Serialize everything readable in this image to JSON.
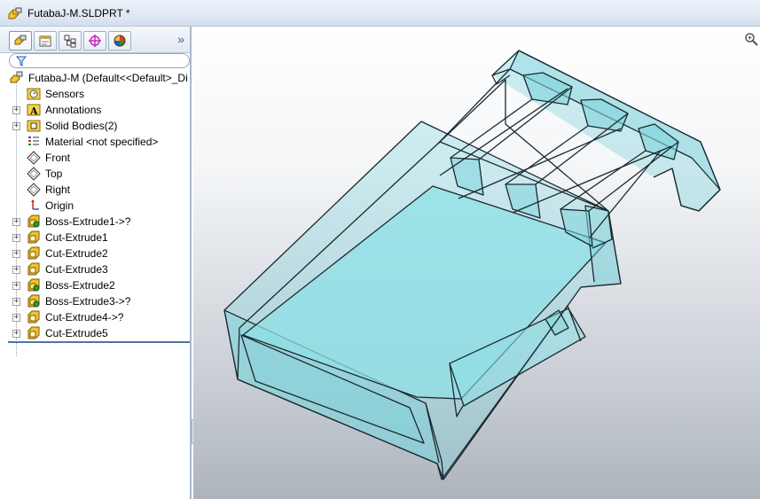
{
  "window": {
    "title": "FutabaJ-M.SLDPRT *"
  },
  "tabs": [
    {
      "icon": "feature-manager-icon"
    },
    {
      "icon": "property-manager-icon"
    },
    {
      "icon": "configuration-manager-icon"
    },
    {
      "icon": "dimxpert-manager-icon"
    },
    {
      "icon": "display-manager-icon"
    }
  ],
  "tabs_more": "»",
  "tree": {
    "root_label": "FutabaJ-M  (Default<<Default>_Di",
    "items": [
      {
        "label": "Sensors",
        "icon": "sensors-icon",
        "expandable": false
      },
      {
        "label": "Annotations",
        "icon": "annotations-icon",
        "expandable": true
      },
      {
        "label": "Solid Bodies(2)",
        "icon": "solid-bodies-icon",
        "expandable": true
      },
      {
        "label": "Material <not specified>",
        "icon": "material-icon",
        "expandable": false
      },
      {
        "label": "Front",
        "icon": "plane-icon",
        "expandable": false
      },
      {
        "label": "Top",
        "icon": "plane-icon",
        "expandable": false
      },
      {
        "label": "Right",
        "icon": "plane-icon",
        "expandable": false
      },
      {
        "label": "Origin",
        "icon": "origin-icon",
        "expandable": false
      },
      {
        "label": "Boss-Extrude1->?",
        "icon": "boss-extrude-icon",
        "expandable": true
      },
      {
        "label": "Cut-Extrude1",
        "icon": "cut-extrude-icon",
        "expandable": true
      },
      {
        "label": "Cut-Extrude2",
        "icon": "cut-extrude-icon",
        "expandable": true
      },
      {
        "label": "Cut-Extrude3",
        "icon": "cut-extrude-icon",
        "expandable": true
      },
      {
        "label": "Boss-Extrude2",
        "icon": "boss-extrude-icon",
        "expandable": true
      },
      {
        "label": "Boss-Extrude3->?",
        "icon": "boss-extrude-icon",
        "expandable": true
      },
      {
        "label": "Cut-Extrude4->?",
        "icon": "cut-extrude-icon",
        "expandable": true
      },
      {
        "label": "Cut-Extrude5",
        "icon": "cut-extrude-icon",
        "expandable": true
      }
    ]
  },
  "colors": {
    "model_fill": "#7fd3dc",
    "model_edge": "#1b2a30",
    "panel_separator": "#4f73a8"
  }
}
